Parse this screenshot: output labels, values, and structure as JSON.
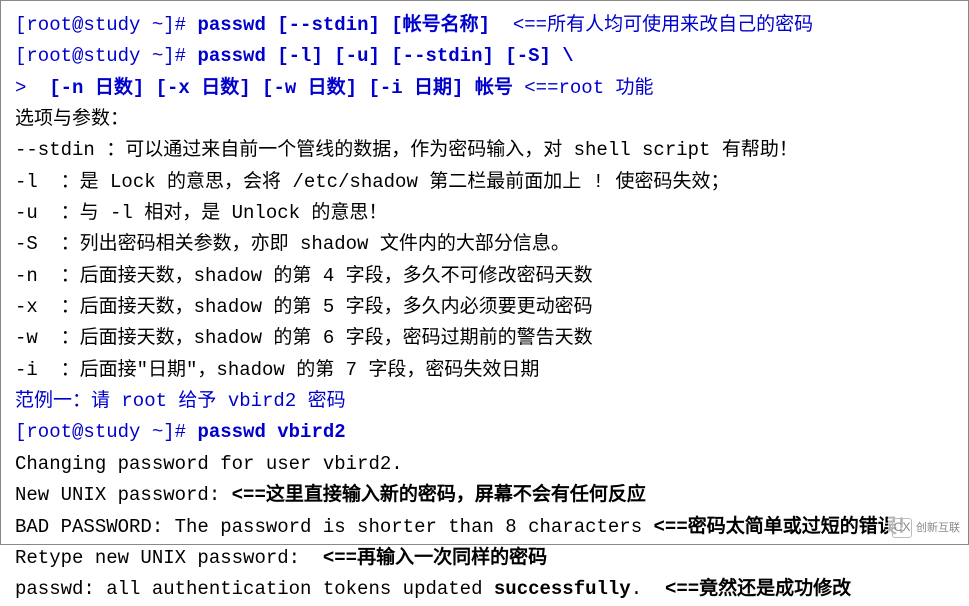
{
  "lines": [
    {
      "parts": [
        {
          "text": "[root@study ~]# ",
          "cls": "blue"
        },
        {
          "text": "passwd [--stdin] [帐号名称]",
          "cls": "blue bold"
        },
        {
          "text": "  <==所有人均可使用来改自己的密码",
          "cls": "blue"
        }
      ]
    },
    {
      "parts": [
        {
          "text": "[root@study ~]# ",
          "cls": "blue"
        },
        {
          "text": "passwd [-l] [-u] [--stdin] [-S] \\",
          "cls": "blue bold"
        }
      ]
    },
    {
      "parts": [
        {
          "text": ">  ",
          "cls": "blue"
        },
        {
          "text": "[-n 日数] [-x 日数] [-w 日数] [-i 日期] 帐号",
          "cls": "blue bold"
        },
        {
          "text": " <==root 功能",
          "cls": "blue"
        }
      ]
    },
    {
      "parts": [
        {
          "text": "选项与参数：",
          "cls": "black"
        }
      ]
    },
    {
      "parts": [
        {
          "text": "--stdin ：可以通过来自前一个管线的数据，作为密码输入，对 shell script 有帮助！",
          "cls": "black"
        }
      ]
    },
    {
      "parts": [
        {
          "text": "-l  ：是 Lock 的意思，会将 /etc/shadow 第二栏最前面加上 ! 使密码失效；",
          "cls": "black"
        }
      ]
    },
    {
      "parts": [
        {
          "text": "-u  ：与 -l 相对，是 Unlock 的意思！",
          "cls": "black"
        }
      ]
    },
    {
      "parts": [
        {
          "text": "-S  ：列出密码相关参数，亦即 shadow 文件内的大部分信息。",
          "cls": "black"
        }
      ]
    },
    {
      "parts": [
        {
          "text": "-n  ：后面接天数，shadow 的第 4 字段，多久不可修改密码天数",
          "cls": "black"
        }
      ]
    },
    {
      "parts": [
        {
          "text": "-x  ：后面接天数，shadow 的第 5 字段，多久内必须要更动密码",
          "cls": "black"
        }
      ]
    },
    {
      "parts": [
        {
          "text": "-w  ：后面接天数，shadow 的第 6 字段，密码过期前的警告天数",
          "cls": "black"
        }
      ]
    },
    {
      "parts": [
        {
          "text": "-i  ：后面接\"日期\"，shadow 的第 7 字段，密码失效日期",
          "cls": "black"
        }
      ]
    },
    {
      "parts": [
        {
          "text": "",
          "cls": "black"
        }
      ]
    },
    {
      "parts": [
        {
          "text": "范例一：请 root 给予 vbird2 密码",
          "cls": "blue"
        }
      ]
    },
    {
      "parts": [
        {
          "text": "[root@study ~]# ",
          "cls": "blue"
        },
        {
          "text": "passwd vbird2",
          "cls": "blue bold"
        }
      ]
    },
    {
      "parts": [
        {
          "text": "Changing password for user vbird2.",
          "cls": "black"
        }
      ]
    },
    {
      "parts": [
        {
          "text": "New UNIX password: ",
          "cls": "black"
        },
        {
          "text": "<==这里直接输入新的密码，屏幕不会有任何反应",
          "cls": "black bold"
        }
      ]
    },
    {
      "parts": [
        {
          "text": "BAD PASSWORD: The password is shorter than 8 characters ",
          "cls": "black"
        },
        {
          "text": "<==密码太简单或过短的错误！",
          "cls": "black bold"
        }
      ]
    },
    {
      "parts": [
        {
          "text": "Retype new UNIX password:  ",
          "cls": "black"
        },
        {
          "text": "<==再输入一次同样的密码",
          "cls": "black bold"
        }
      ]
    },
    {
      "parts": [
        {
          "text": "passwd: all authentication tokens updated ",
          "cls": "black"
        },
        {
          "text": "successfully",
          "cls": "black bold"
        },
        {
          "text": ".  ",
          "cls": "black"
        },
        {
          "text": "<==竟然还是成功修改",
          "cls": "black bold"
        }
      ]
    }
  ],
  "watermark": {
    "icon": "CX",
    "text": "创新互联"
  }
}
